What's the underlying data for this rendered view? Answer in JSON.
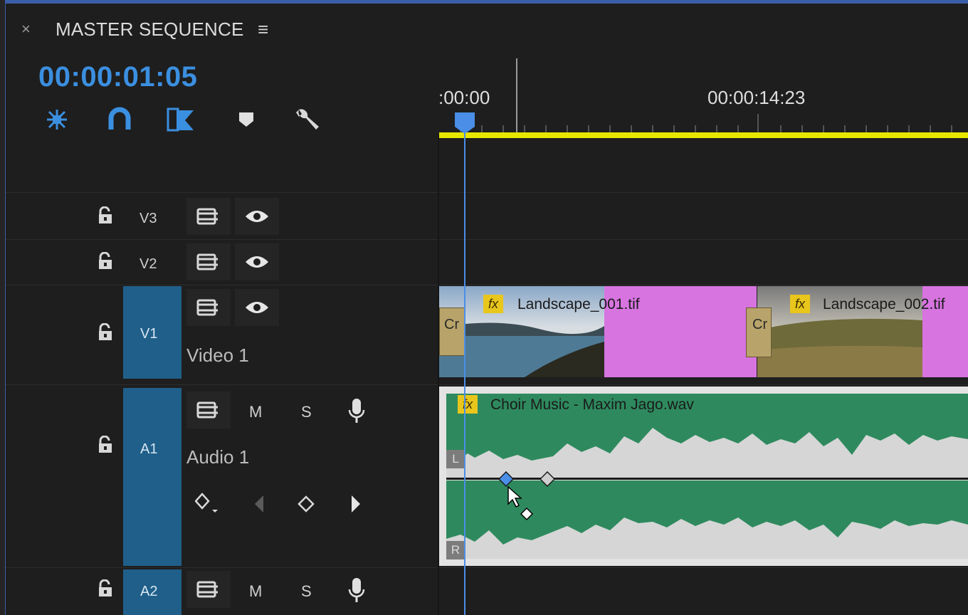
{
  "panel": {
    "close": "×",
    "title": "MASTER SEQUENCE",
    "menu": "≡"
  },
  "timecode": "00:00:01:05",
  "ruler": {
    "start": ":00:00",
    "mid": "00:00:14:23"
  },
  "tools": [
    {
      "name": "nest-toggle-icon"
    },
    {
      "name": "snap-magnet-icon"
    },
    {
      "name": "linked-selection-icon"
    },
    {
      "name": "add-marker-icon"
    },
    {
      "name": "wrench-settings-icon"
    }
  ],
  "tracks": {
    "v3": {
      "label": "V3"
    },
    "v2": {
      "label": "V2"
    },
    "v1": {
      "label": "V1",
      "name": "Video 1"
    },
    "a1": {
      "label": "A1",
      "name": "Audio 1",
      "mute": "M",
      "solo": "S"
    },
    "a2": {
      "label": "A2",
      "mute": "M",
      "solo": "S"
    }
  },
  "clips": {
    "video1": {
      "label": "Landscape_001.tif",
      "transition": "Cr",
      "fx": "fx"
    },
    "video2": {
      "label": "Landscape_002.tif",
      "transition": "Cr",
      "fx": "fx"
    },
    "audio": {
      "label": "Choir Music - Maxim Jago.wav",
      "fx": "fx",
      "left": "L",
      "right": "R"
    }
  },
  "colors": {
    "accent": "#3b8fe0",
    "target": "#1f5f8a",
    "video_clip": "#d774e0",
    "audio_clip": "#2e8a5e",
    "work_area": "#e6e600"
  }
}
